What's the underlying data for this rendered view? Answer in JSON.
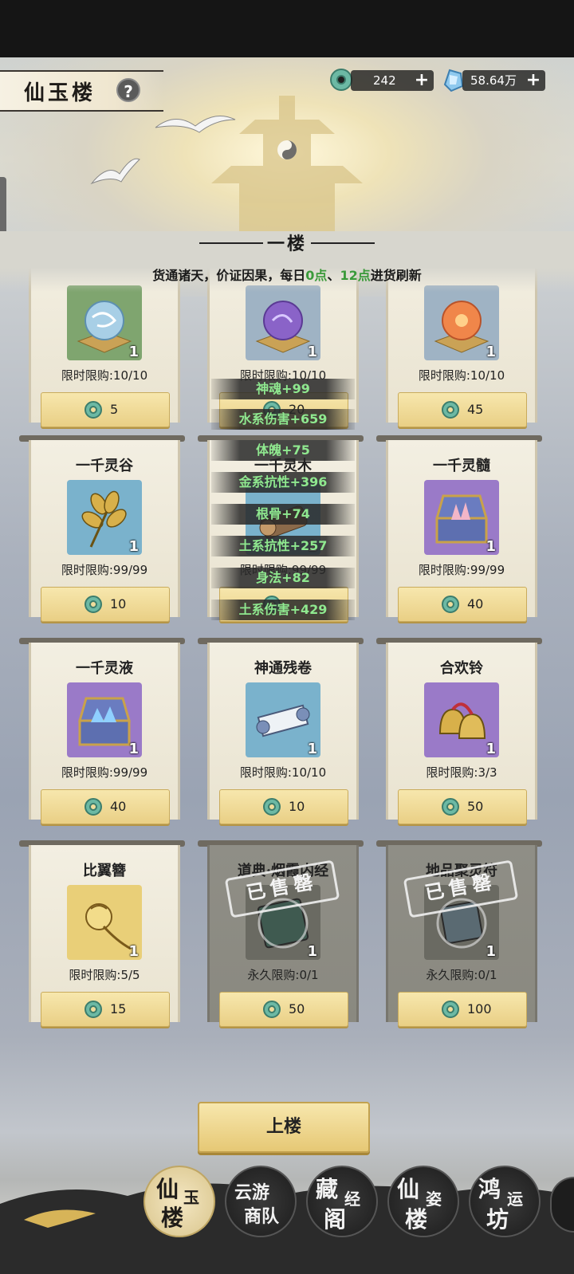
{
  "header": {
    "title": "仙玉楼",
    "help_icon": "question-icon",
    "currencies": [
      {
        "icon": "jade-coin-icon",
        "value": "242"
      },
      {
        "icon": "spirit-crystal-icon",
        "value": "58.64万"
      }
    ]
  },
  "floor": {
    "title": "一楼",
    "subtitle_a": "货通诸天，价证因果，每日",
    "subtitle_b": "0点",
    "subtitle_c": "、",
    "subtitle_d": "12点",
    "subtitle_e": "进货刷新"
  },
  "items": [
    {
      "name": "",
      "qty": "1",
      "limit": "限时限购:10/10",
      "price": "5",
      "icon": "blue-orb-icon"
    },
    {
      "name": "",
      "qty": "1",
      "limit": "限时限购:10/10",
      "price": "20",
      "icon": "purple-orb-icon"
    },
    {
      "name": "",
      "qty": "1",
      "limit": "限时限购:10/10",
      "price": "45",
      "icon": "orange-orb-icon"
    },
    {
      "name": "一千灵谷",
      "qty": "1",
      "limit": "限时限购:99/99",
      "price": "10",
      "icon": "golden-grain-icon"
    },
    {
      "name": "一千灵木",
      "qty": "1",
      "limit": "限时限购:99/99",
      "price": "",
      "icon": "spirit-wood-icon"
    },
    {
      "name": "一千灵髓",
      "qty": "1",
      "limit": "限时限购:99/99",
      "price": "40",
      "icon": "treasure-chest-pink-icon"
    },
    {
      "name": "一千灵液",
      "qty": "1",
      "limit": "限时限购:99/99",
      "price": "40",
      "icon": "treasure-chest-blue-icon"
    },
    {
      "name": "神通残卷",
      "qty": "1",
      "limit": "限时限购:10/10",
      "price": "10",
      "icon": "scroll-icon"
    },
    {
      "name": "合欢铃",
      "qty": "1",
      "limit": "限时限购:3/3",
      "price": "50",
      "icon": "bells-icon"
    },
    {
      "name": "比翼簪",
      "qty": "1",
      "limit": "限时限购:5/5",
      "price": "15",
      "icon": "hairpin-icon"
    },
    {
      "name": "道典·烟霞内经",
      "qty": "1",
      "limit": "永久限购:0/1",
      "price": "50",
      "icon": "book-icon",
      "sold": "已售罄"
    },
    {
      "name": "地品聚灵符",
      "qty": "1",
      "limit": "永久限购:0/1",
      "price": "100",
      "icon": "talisman-icon",
      "sold": "已售罄"
    }
  ],
  "stat_popups": [
    "神魂+99",
    "水系伤害+659",
    "体魄+75",
    "金系抗性+396",
    "根骨+74",
    "土系抗性+257",
    "身法+82",
    "土系伤害+429"
  ],
  "upstairs_label": "上楼",
  "bottom_nav": [
    {
      "t1": "仙",
      "t2": "玉",
      "t3": "楼",
      "active": true
    },
    {
      "t1": "云游",
      "t2": "商队"
    },
    {
      "t1": "藏",
      "t2": "经",
      "t3": "阁"
    },
    {
      "t1": "仙",
      "t2": "姿",
      "t3": "楼"
    },
    {
      "t1": "鸿",
      "t2": "运",
      "t3": "坊"
    }
  ],
  "colors": {
    "jade": "#5fae9a",
    "highlight_green": "#3a9a3a",
    "stat_green": "#8fe88f",
    "gold_button": "#ecd28c"
  }
}
